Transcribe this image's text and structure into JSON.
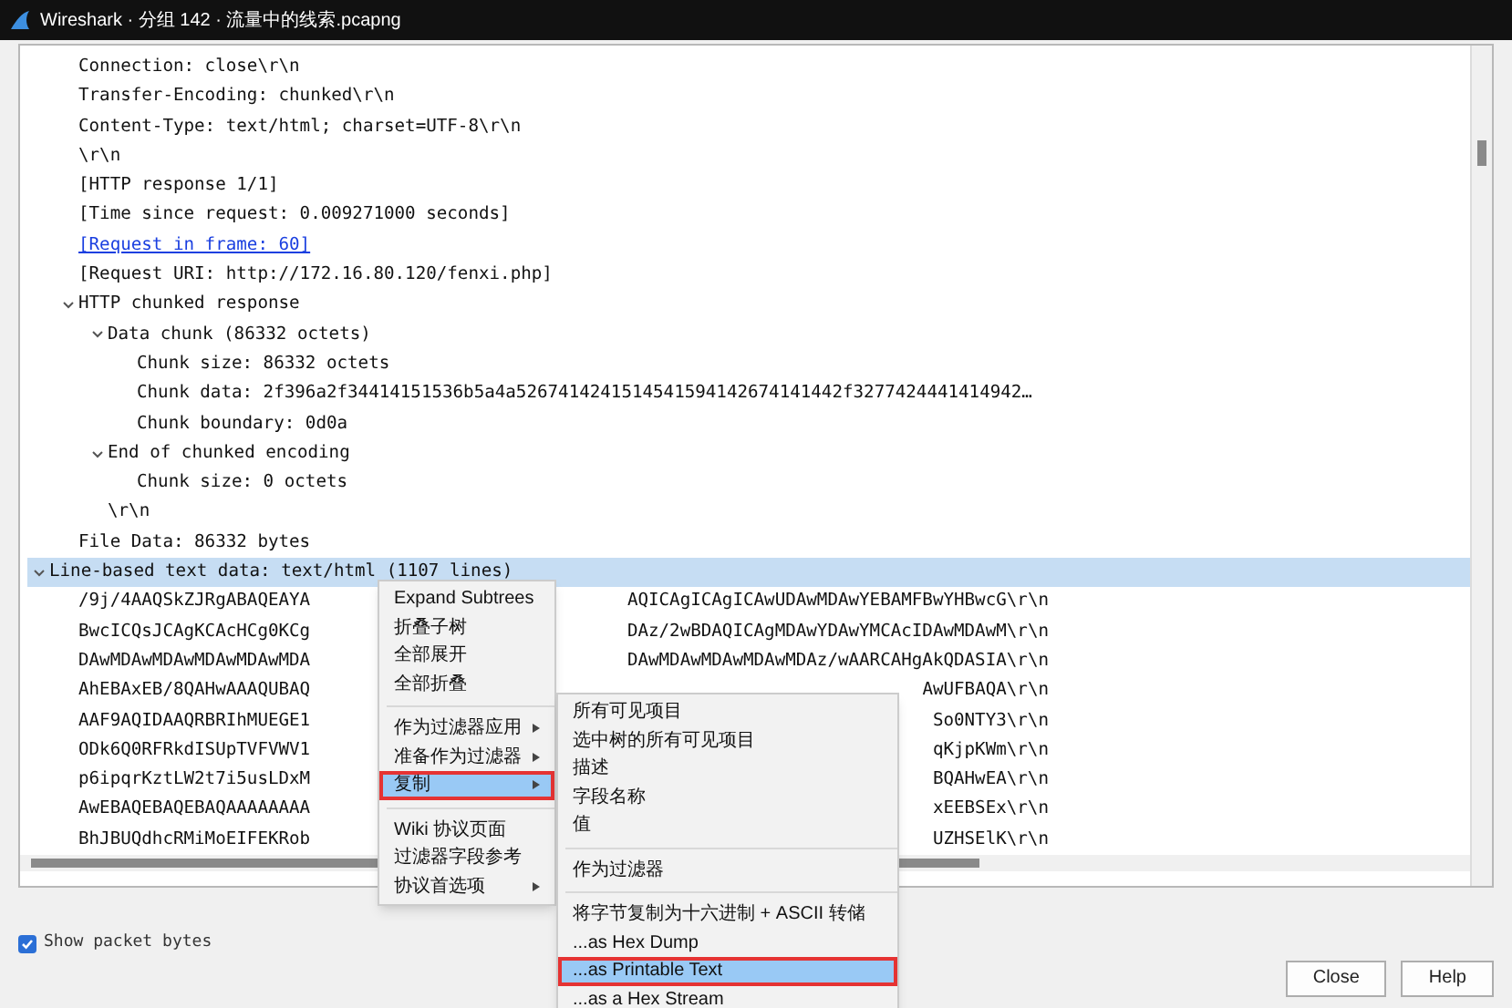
{
  "window": {
    "title": "Wireshark · 分组 142 · 流量中的线索.pcapng"
  },
  "tree": [
    {
      "children": [
        {
          "text": "Connection: close\\r\\n"
        },
        {
          "text": "Transfer-Encoding: chunked\\r\\n"
        },
        {
          "text": "Content-Type: text/html; charset=UTF-8\\r\\n"
        },
        {
          "text": "\\r\\n"
        },
        {
          "text": "[HTTP response 1/1]"
        },
        {
          "text": "[Time since request: 0.009271000 seconds]"
        },
        {
          "text": "[Request in frame: 60]",
          "kind": "link"
        },
        {
          "text": "[Request URI: http://172.16.80.120/fenxi.php]"
        },
        {
          "text": "HTTP chunked response",
          "expanded": true,
          "children": [
            {
              "text": "Data chunk (86332 octets)",
              "expanded": true,
              "children": [
                {
                  "text": "Chunk size: 86332 octets"
                },
                {
                  "text": "Chunk data: 2f396a2f34414151536b5a4a5267414241514541594142674141442f3277424441414942…"
                },
                {
                  "text": "Chunk boundary: 0d0a"
                }
              ]
            },
            {
              "text": "End of chunked encoding",
              "expanded": true,
              "children": [
                {
                  "text": "Chunk size: 0 octets"
                }
              ]
            },
            {
              "text": "\\r\\n"
            }
          ]
        },
        {
          "text": "File Data: 86332 bytes"
        }
      ]
    },
    {
      "text": "Line-based text data: text/html (1107 lines)",
      "expanded": true,
      "selected": true,
      "children": [
        {
          "text": "/9j/4AAQSkZJRgABAQEAYA",
          "text_after": "AQICAgICAgICAwUDAwMDAwYEBAMFBwYHBwcG\\r\\n"
        },
        {
          "text": "BwcICQsJCAgKCAcHCg0KCg",
          "text_after": "DAz/2wBDAQICAgMDAwYDAwYMCAcIDAwMDAwM\\r\\n"
        },
        {
          "text": "DAwMDAwMDAwMDAwMDAwMDA",
          "text_after": "DAwMDAwMDAwMDAwMDAz/wAARCAHgAkQDASIA\\r\\n"
        },
        {
          "text": "AhEBAxEB/8QAHwAAAQUBAQ",
          "text_after": "AwUFBAQA\\r\\n"
        },
        {
          "text": "AAF9AQIDAAQRBRIhMUEGE1",
          "text_after": "So0NTY3\\r\\n"
        },
        {
          "text": "ODk6Q0RFRkdISUpTVFVWV1",
          "text_after": "qKjpKWm\\r\\n"
        },
        {
          "text": "p6ipqrKztLW2t7i5usLDxM",
          "text_after": "BQAHwEA\\r\\n"
        },
        {
          "text": "AwEBAQEBAQEBAQAAAAAAAA",
          "text_after": "xEEBSEx\\r\\n"
        },
        {
          "text": "BhJBUQdhcRMiMoEIFEKRob",
          "text_after": "UZHSElK\\r\\n"
        }
      ]
    }
  ],
  "show_packet_bytes": {
    "label": "Show packet bytes",
    "checked": true
  },
  "buttons": [
    "Close",
    "Help"
  ],
  "context_menu": [
    {
      "kind": "item",
      "label": "Expand Subtrees"
    },
    {
      "kind": "item",
      "label": "折叠子树"
    },
    {
      "kind": "item",
      "label": "全部展开"
    },
    {
      "kind": "item",
      "label": "全部折叠"
    },
    {
      "kind": "separator"
    },
    {
      "kind": "item",
      "label": "作为过滤器应用",
      "submenu": true
    },
    {
      "kind": "item",
      "label": "准备作为过滤器",
      "submenu": true
    },
    {
      "kind": "item",
      "label": "复制",
      "submenu": true,
      "selected": true,
      "annotated": true
    },
    {
      "kind": "separator"
    },
    {
      "kind": "item",
      "label": "Wiki 协议页面"
    },
    {
      "kind": "item",
      "label": "过滤器字段参考"
    },
    {
      "kind": "item",
      "label": "协议首选项",
      "submenu": true
    }
  ],
  "copy_submenu": [
    {
      "kind": "item",
      "label": "所有可见项目"
    },
    {
      "kind": "item",
      "label": "选中树的所有可见项目"
    },
    {
      "kind": "item",
      "label": "描述"
    },
    {
      "kind": "item",
      "label": "字段名称"
    },
    {
      "kind": "item",
      "label": "值"
    },
    {
      "kind": "separator"
    },
    {
      "kind": "item",
      "label": "作为过滤器"
    },
    {
      "kind": "separator"
    },
    {
      "kind": "item",
      "label": "将字节复制为十六进制 + ASCII 转储"
    },
    {
      "kind": "item",
      "label": "...as Hex Dump"
    },
    {
      "kind": "item",
      "label": "...as Printable Text",
      "selected": true,
      "annotated": true
    },
    {
      "kind": "item",
      "label": "...as a Hex Stream"
    }
  ]
}
